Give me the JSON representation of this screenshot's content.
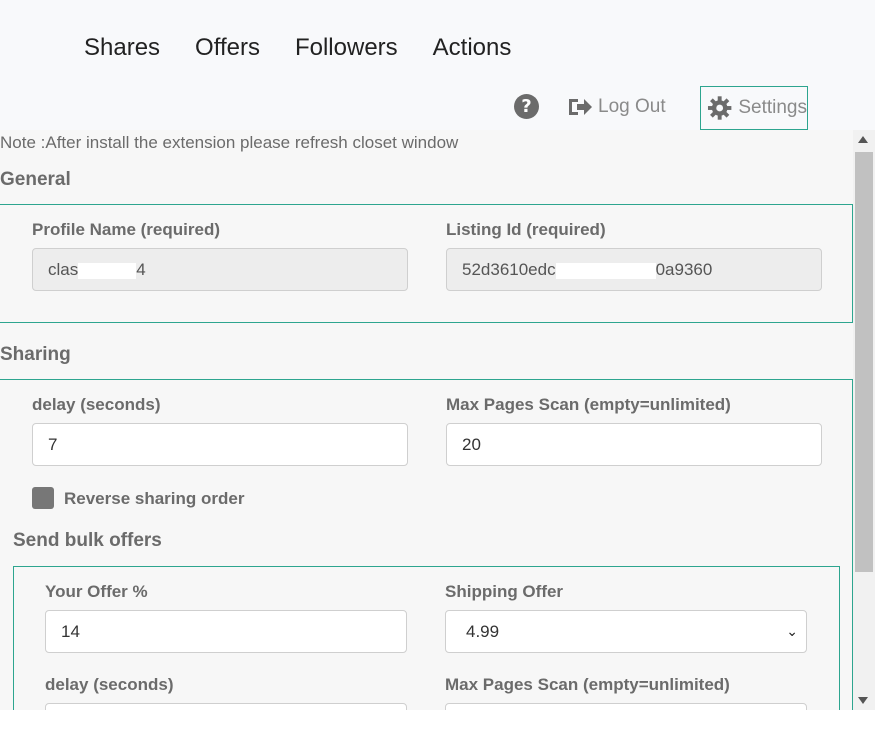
{
  "nav": {
    "items": [
      {
        "label": "Shares"
      },
      {
        "label": "Offers"
      },
      {
        "label": "Followers"
      },
      {
        "label": "Actions"
      }
    ]
  },
  "toolbar": {
    "help_icon": "question-circle",
    "logout_label": "Log Out",
    "settings_label": "Settings"
  },
  "note": "Note :After install the extension please refresh closet window",
  "general": {
    "title": "General",
    "profile_label": "Profile Name (required)",
    "profile_value_prefix": "clas",
    "profile_value_suffix": "4",
    "listing_label": "Listing Id (required)",
    "listing_value_prefix": "52d3610edc",
    "listing_value_suffix": "0a9360"
  },
  "sharing": {
    "title": "Sharing",
    "delay_label": "delay (seconds)",
    "delay_value": "7",
    "max_pages_label": "Max Pages Scan (empty=unlimited)",
    "max_pages_value": "20",
    "reverse_label": "Reverse sharing order"
  },
  "bulk_offers": {
    "title": "Send bulk offers",
    "offer_label": "Your Offer %",
    "offer_value": "14",
    "shipping_label": "Shipping Offer",
    "shipping_value": "4.99",
    "delay_label": "delay (seconds)",
    "max_pages_label": "Max Pages Scan (empty=unlimited)"
  },
  "colors": {
    "accent": "#2da58f",
    "label_gray": "#6b6b6b"
  }
}
